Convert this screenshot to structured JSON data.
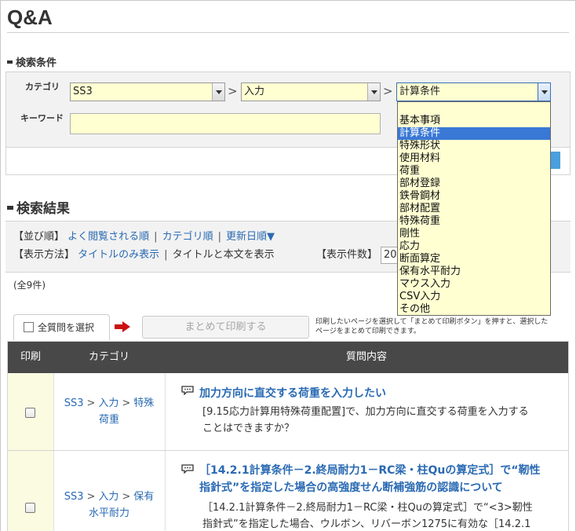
{
  "page": {
    "title": "Q&A"
  },
  "search": {
    "heading": "検索条件",
    "category_label": "カテゴリ",
    "keyword_label": "キーワード",
    "category1": "SS3",
    "category2": "入力",
    "category3": "計算条件",
    "gt": ">",
    "keyword_value": "",
    "dropdown_options": [
      "基本事項",
      "計算条件",
      "特殊形状",
      "使用材料",
      "荷重",
      "部材登録",
      "鉄骨鋼材",
      "部材配置",
      "特殊荷重",
      "剛性",
      "応力",
      "断面算定",
      "保有水平耐力",
      "マウス入力",
      "CSV入力",
      "その他"
    ],
    "dropdown_selected": "計算条件"
  },
  "results": {
    "heading": "検索結果",
    "sort_label": "【並び順】",
    "sort_options": [
      "よく閲覧される順",
      "カテゴリ順",
      "更新日順▼"
    ],
    "display_label": "【表示方法】",
    "display_options": [
      "タイトルのみ表示",
      "タイトルと本文を表示"
    ],
    "count_label": "【表示件数】",
    "count_value": "20",
    "total": "(全9件)",
    "select_all": "全質問を選択",
    "print_button": "まとめて印刷する",
    "print_note": "印刷したいページを選択して「まとめて印刷ボタン」を押すと、選択したページをまとめて印刷できます。",
    "columns": [
      "印刷",
      "カテゴリ",
      "質問内容"
    ],
    "rows": [
      {
        "cat1": "SS3",
        "cat2": "入力",
        "cat3_a": "特殊",
        "cat3_b": "荷重",
        "title": "加力方向に直交する荷重を入力したい",
        "body_1": "[9.15応力計算用特殊荷重配置]で、加力方向に直交する荷重を入力する",
        "body_2": "ことはできますか？"
      },
      {
        "cat1": "SS3",
        "cat2": "入力",
        "cat3_a": "保有",
        "cat3_b": "水平耐力",
        "title_1": "［14.2.1計算条件－2.終局耐力1－RC梁・柱Quの算定式］で“靭性",
        "title_2": "指針式”を指定した場合の高強度せん断補強筋の認識について",
        "body_1": "［14.2.1計算条件－2.終局耐力1－RC梁・柱Quの算定式］で“<3>靭性",
        "body_2": "指針式”を指定した場合、ウルボン、リバーボン1275に有効な［14.2.1"
      }
    ]
  },
  "colors": {
    "input_bg": "#ffffd2",
    "header_bg": "#484848",
    "link": "#2a6ab3",
    "highlight": "#3a78d6",
    "arrow_red": "#cc1111"
  }
}
